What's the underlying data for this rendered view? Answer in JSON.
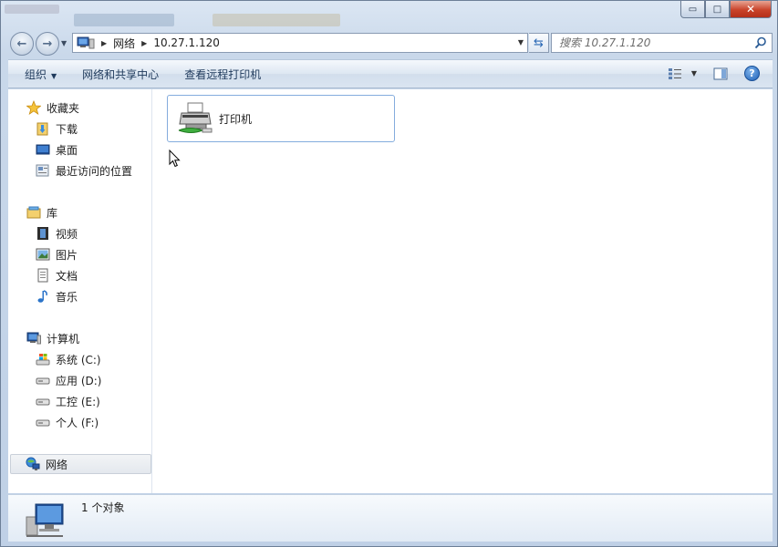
{
  "window": {
    "minimize_glyph": "▭",
    "maximize_glyph": "□",
    "close_glyph": "✕"
  },
  "address": {
    "crumbs": [
      "网络",
      "10.27.1.120"
    ]
  },
  "search": {
    "placeholder": "搜索 10.27.1.120"
  },
  "commands": {
    "organize": "组织",
    "network_center": "网络和共享中心",
    "view_remote_printers": "查看远程打印机"
  },
  "nav": {
    "favorites": {
      "label": "收藏夹",
      "items": [
        "下载",
        "桌面",
        "最近访问的位置"
      ]
    },
    "libraries": {
      "label": "库",
      "items": [
        "视频",
        "图片",
        "文档",
        "音乐"
      ]
    },
    "computer": {
      "label": "计算机",
      "items": [
        "系统 (C:)",
        "应用 (D:)",
        "工控 (E:)",
        "个人 (F:)"
      ]
    },
    "network": {
      "label": "网络"
    }
  },
  "content": {
    "items": [
      {
        "label": "打印机",
        "icon": "shared-printer-icon"
      }
    ]
  },
  "details": {
    "count_text": "1 个对象"
  },
  "colors": {
    "selection_border": "#84acdd",
    "close_button": "#c9432a",
    "link_text": "#1e395b"
  }
}
